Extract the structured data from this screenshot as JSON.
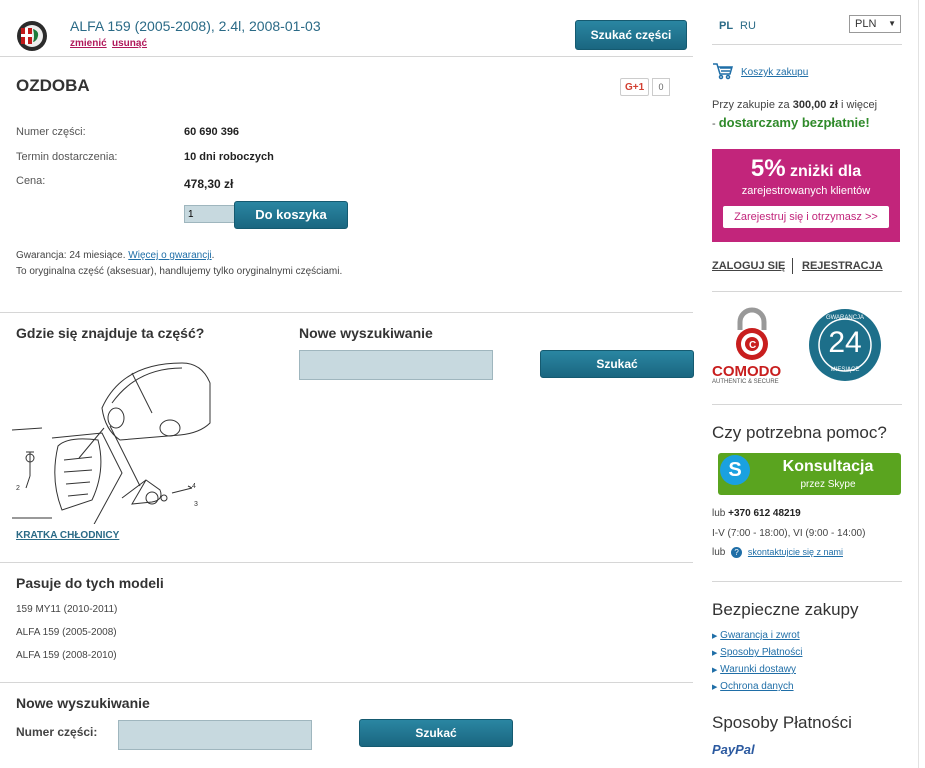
{
  "header": {
    "vehicle": "ALFA 159 (2005-2008), 2.4l, 2008-01-03",
    "change_link": "zmienić",
    "remove_link": "usunąć",
    "search_parts_button": "Szukać części"
  },
  "part": {
    "title": "OZDOBA",
    "gplus_label": "G+1",
    "gplus_count": "0",
    "fields": [
      {
        "label": "Numer części:",
        "value": "60 690 396"
      },
      {
        "label": "Termin dostarczenia:",
        "value": "10 dni roboczych"
      },
      {
        "label": "Cena:",
        "value": "478,30 zł"
      }
    ],
    "quantity": "1",
    "add_to_cart_button": "Do koszyka",
    "warranty_text": "Gwarancja: 24 miesiące.",
    "warranty_link": "Więcej o gwarancji",
    "original_text": "To oryginalna część (aksesuar), handlujemy tylko oryginalnymi częściami."
  },
  "location": {
    "heading": "Gdzie się znajduje ta część?",
    "diagram_link": "KRATKA CHŁODNICY"
  },
  "new_search": {
    "heading": "Nowe wyszukiwanie",
    "button": "Szukać"
  },
  "models": {
    "heading": "Pasuje do tych modeli",
    "items": [
      "159 MY11 (2010-2011)",
      "ALFA 159 (2005-2008)",
      "ALFA 159 (2008-2010)"
    ]
  },
  "bottom_search": {
    "heading": "Nowe wyszukiwanie",
    "label": "Numer części:",
    "button": "Szukać"
  },
  "sidebar": {
    "lang_pl": "PL",
    "lang_ru": "RU",
    "currency": "PLN",
    "cart_link": "Koszyk zakupu",
    "shipping_text_1": "Przy zakupie za",
    "shipping_amount": "300,00 zł",
    "shipping_text_2": "i więcej",
    "shipping_free": "dostarczamy bezpłatnie!",
    "promo_pct": "5%",
    "promo_text": "zniżki dla",
    "promo_sub": "zarejestrowanych klientów",
    "promo_button": "Zarejestruj się i otrzymasz >>",
    "login_link": "ZALOGUJ SIĘ",
    "register_link": "REJESTRACJA",
    "comodo_text": "COMODO",
    "comodo_sub": "AUTHENTIC & SECURE",
    "seal_top": "GWARANCJA",
    "seal_number": "24",
    "seal_bottom": "MIESIĄCE",
    "help_heading": "Czy potrzebna pomoc?",
    "skype_title": "Konsultacja",
    "skype_sub": "przez Skype",
    "phone_prefix": "lub",
    "phone": "+370 612 48219",
    "hours": "I-V (7:00 - 18:00), VI (9:00 - 14:00)",
    "contact_prefix": "lub",
    "contact_link": "skontaktujcie się z nami",
    "safe_heading": "Bezpieczne zakupy",
    "safe_links": [
      "Gwarancja i zwrot",
      "Sposoby Płatności",
      "Warunki dostawy",
      "Ochrona danych"
    ],
    "payments_heading": "Sposoby Płatności",
    "paypal": "PayPal"
  },
  "colors": {
    "teal": "#1d6f8a",
    "promo_pink": "#c2257b",
    "green": "#2f8a2a",
    "skype_green": "#5aa41f"
  }
}
